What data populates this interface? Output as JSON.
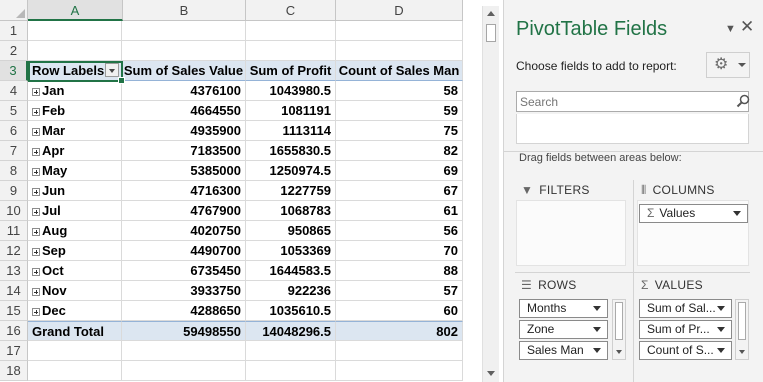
{
  "sheet": {
    "columns": [
      "A",
      "B",
      "C",
      "D"
    ],
    "selected_column": "A",
    "row_numbers": [
      "1",
      "2",
      "3",
      "4",
      "5",
      "6",
      "7",
      "8",
      "9",
      "10",
      "11",
      "12",
      "13",
      "14",
      "15",
      "16",
      "17",
      "18"
    ],
    "selected_row": "3",
    "pivot_header": {
      "row_labels": "Row Labels",
      "sum_sales": "Sum of Sales Value",
      "sum_profit": "Sum of Profit",
      "count_salesman": "Count of Sales Man"
    },
    "rows": [
      {
        "label": "Jan",
        "sales": "4376100",
        "profit": "1043980.5",
        "count": "58"
      },
      {
        "label": "Feb",
        "sales": "4664550",
        "profit": "1081191",
        "count": "59"
      },
      {
        "label": "Mar",
        "sales": "4935900",
        "profit": "1113114",
        "count": "75"
      },
      {
        "label": "Apr",
        "sales": "7183500",
        "profit": "1655830.5",
        "count": "82"
      },
      {
        "label": "May",
        "sales": "5385000",
        "profit": "1250974.5",
        "count": "69"
      },
      {
        "label": "Jun",
        "sales": "4716300",
        "profit": "1227759",
        "count": "67"
      },
      {
        "label": "Jul",
        "sales": "4767900",
        "profit": "1068783",
        "count": "61"
      },
      {
        "label": "Aug",
        "sales": "4020750",
        "profit": "950865",
        "count": "56"
      },
      {
        "label": "Sep",
        "sales": "4490700",
        "profit": "1053369",
        "count": "70"
      },
      {
        "label": "Oct",
        "sales": "6735450",
        "profit": "1644583.5",
        "count": "88"
      },
      {
        "label": "Nov",
        "sales": "3933750",
        "profit": "922236",
        "count": "57"
      },
      {
        "label": "Dec",
        "sales": "4288650",
        "profit": "1035610.5",
        "count": "60"
      }
    ],
    "grand_total": {
      "label": "Grand Total",
      "sales": "59498550",
      "profit": "14048296.5",
      "count": "802"
    }
  },
  "pane": {
    "title": "PivotTable Fields",
    "choose_text": "Choose fields to add to report:",
    "search_placeholder": "Search",
    "drag_text": "Drag fields between areas below:",
    "filters_label": "FILTERS",
    "columns_label": "COLUMNS",
    "rows_label": "ROWS",
    "values_label": "VALUES",
    "columns_fields": [
      "Values"
    ],
    "rows_fields": [
      "Months",
      "Zone",
      "Sales Man"
    ],
    "values_fields": [
      "Sum of Sal...",
      "Sum of Pr...",
      "Count of S..."
    ],
    "icons": {
      "filters": "funnel-icon",
      "columns": "columns-icon",
      "rows": "rows-icon",
      "values": "sigma-icon",
      "settings": "gear-icon",
      "search": "search-icon",
      "close": "close-icon"
    }
  },
  "colors": {
    "accent": "#217346",
    "pivot_header_fill": "#dce6f1"
  }
}
